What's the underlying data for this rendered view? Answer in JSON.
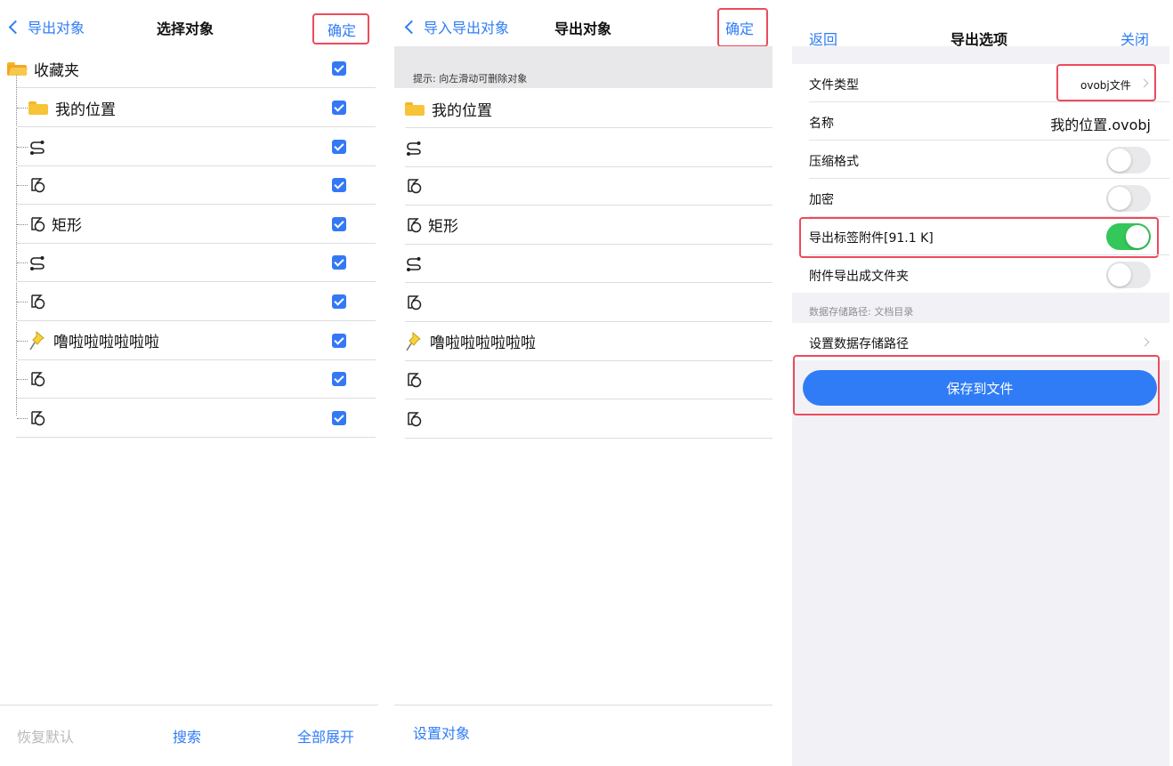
{
  "colors": {
    "accent": "#2f7cf6",
    "highlight_border": "#ec4b5c",
    "toggle_on": "#34c759",
    "folder": "#f7c337"
  },
  "panel1": {
    "back_label": "导出对象",
    "title": "选择对象",
    "confirm_label": "确定",
    "root_label": "收藏夹",
    "items": [
      {
        "icon": "folder-icon",
        "label": "我的位置"
      },
      {
        "icon": "route-icon",
        "label": ""
      },
      {
        "icon": "shape-icon",
        "label": ""
      },
      {
        "icon": "shape-icon",
        "label": "矩形"
      },
      {
        "icon": "route-icon",
        "label": ""
      },
      {
        "icon": "shape-icon",
        "label": ""
      },
      {
        "icon": "pushpin-icon",
        "label": "噜啦啦啦啦啦啦"
      },
      {
        "icon": "shape-icon",
        "label": ""
      },
      {
        "icon": "shape-icon",
        "label": ""
      }
    ],
    "bottom": {
      "reset_label": "恢复默认",
      "search_label": "搜索",
      "expand_label": "全部展开"
    }
  },
  "panel2": {
    "back_label": "导入导出对象",
    "title": "导出对象",
    "confirm_label": "确定",
    "hint": "提示: 向左滑动可删除对象",
    "items": [
      {
        "icon": "folder-icon",
        "label": "我的位置"
      },
      {
        "icon": "route-icon",
        "label": ""
      },
      {
        "icon": "shape-icon",
        "label": ""
      },
      {
        "icon": "shape-icon",
        "label": "矩形"
      },
      {
        "icon": "route-icon",
        "label": ""
      },
      {
        "icon": "shape-icon",
        "label": ""
      },
      {
        "icon": "pushpin-icon",
        "label": "噜啦啦啦啦啦啦"
      },
      {
        "icon": "shape-icon",
        "label": ""
      },
      {
        "icon": "shape-icon",
        "label": ""
      }
    ],
    "bottom": {
      "set_objects_label": "设置对象"
    }
  },
  "panel3": {
    "back_label": "返回",
    "title": "导出选项",
    "close_label": "关闭",
    "file_type_label": "文件类型",
    "file_type_value": "ovobj文件",
    "name_label": "名称",
    "name_value": "我的位置.ovobj",
    "compress_label": "压缩格式",
    "encrypt_label": "加密",
    "export_attach_label": "导出标签附件[91.1 K]",
    "attach_folder_label": "附件导出成文件夹",
    "storage_hint": "数据存储路径: 文档目录",
    "set_storage_label": "设置数据存储路径",
    "save_button_label": "保存到文件",
    "toggles": {
      "compress": false,
      "encrypt": false,
      "export_attach": true,
      "attach_folder": false
    }
  }
}
